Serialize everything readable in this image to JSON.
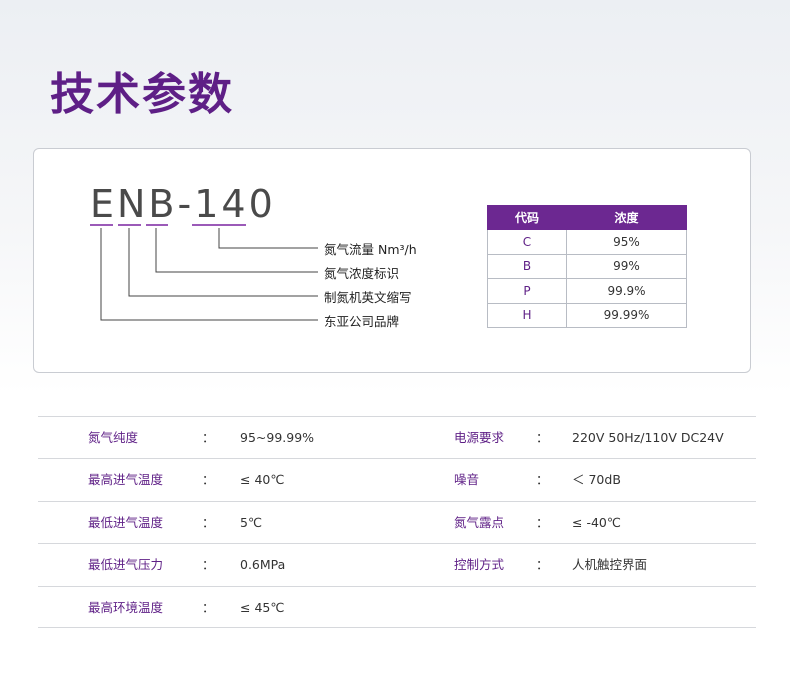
{
  "title": "技术参数",
  "model": {
    "code": "ENB-140",
    "legend": [
      "氮气流量 Nm³/h",
      "氮气浓度标识",
      "制氮机英文缩写",
      "东亚公司品牌"
    ]
  },
  "purity_table": {
    "headers": [
      "代码",
      "浓度"
    ],
    "rows": [
      {
        "code": "C",
        "purity": "95%"
      },
      {
        "code": "B",
        "purity": "99%"
      },
      {
        "code": "P",
        "purity": "99.9%"
      },
      {
        "code": "H",
        "purity": "99.99%"
      }
    ]
  },
  "params": [
    {
      "left": {
        "label": "氮气纯度",
        "value": "95~99.99%"
      },
      "right": {
        "label": "电源要求",
        "value": "220V  50Hz/110V DC24V"
      }
    },
    {
      "left": {
        "label": "最高进气温度",
        "value": "≤ 40℃"
      },
      "right": {
        "label": "噪音",
        "value": "＜ 70dB"
      }
    },
    {
      "left": {
        "label": "最低进气温度",
        "value": "5℃"
      },
      "right": {
        "label": "氮气露点",
        "value": "≤ -40℃"
      }
    },
    {
      "left": {
        "label": "最低进气压力",
        "value": "0.6MPa"
      },
      "right": {
        "label": "控制方式",
        "value": "人机触控界面"
      }
    },
    {
      "left": {
        "label": "最高环境温度",
        "value": "≤ 45℃"
      }
    }
  ],
  "colon": "：",
  "colors": {
    "accent": "#5e1f86",
    "table_header": "#6c2891",
    "underline": "#9b5ab8",
    "leader_line": "#444444"
  }
}
